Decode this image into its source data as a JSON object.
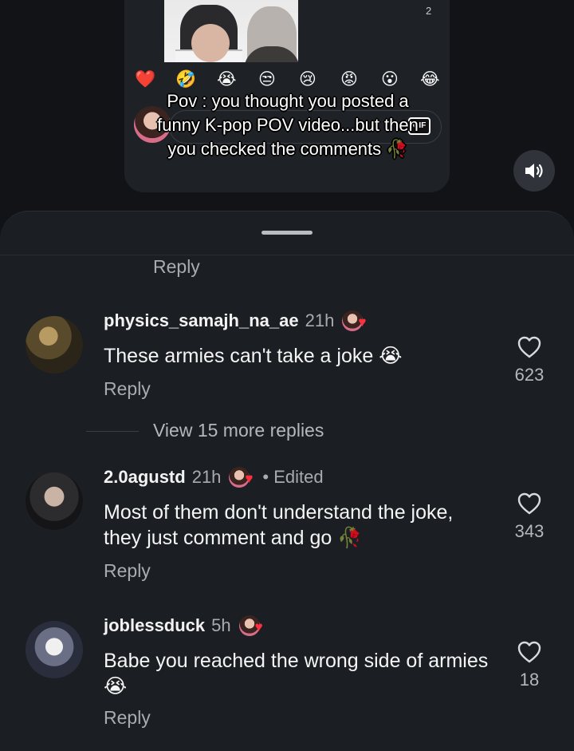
{
  "preview": {
    "count": "2",
    "emojis": [
      "❤️",
      "🤣",
      "😭",
      "😒",
      "😢",
      "😡",
      "😮",
      "😂"
    ],
    "caption": "Pov : you thought you posted a funny K-pop POV video...but then you checked the comments 🥀",
    "gif_label": "GIF"
  },
  "sound": {
    "icon": "speaker-icon"
  },
  "sheet": {
    "top_reply": "Reply",
    "view_more": "View 15 more replies"
  },
  "comments": [
    {
      "username": "physics_samajh_na_ae",
      "time": "21h",
      "edited": "",
      "text": "These armies can't take a joke 😭",
      "reply": "Reply",
      "likes": "623"
    },
    {
      "username": "2.0agustd",
      "time": "21h",
      "edited": "• Edited",
      "text": "Most of them don't understand the joke, they just comment and go 🥀",
      "reply": "Reply",
      "likes": "343"
    },
    {
      "username": "joblessduck",
      "time": "5h",
      "edited": "",
      "text": "Babe you reached the wrong side of armies😭",
      "reply": "Reply",
      "likes": "18"
    }
  ],
  "colors": {
    "background": "#111316",
    "sheet": "#1b1e22",
    "muted": "#a8acb1",
    "heart": "#ff2d3d"
  }
}
